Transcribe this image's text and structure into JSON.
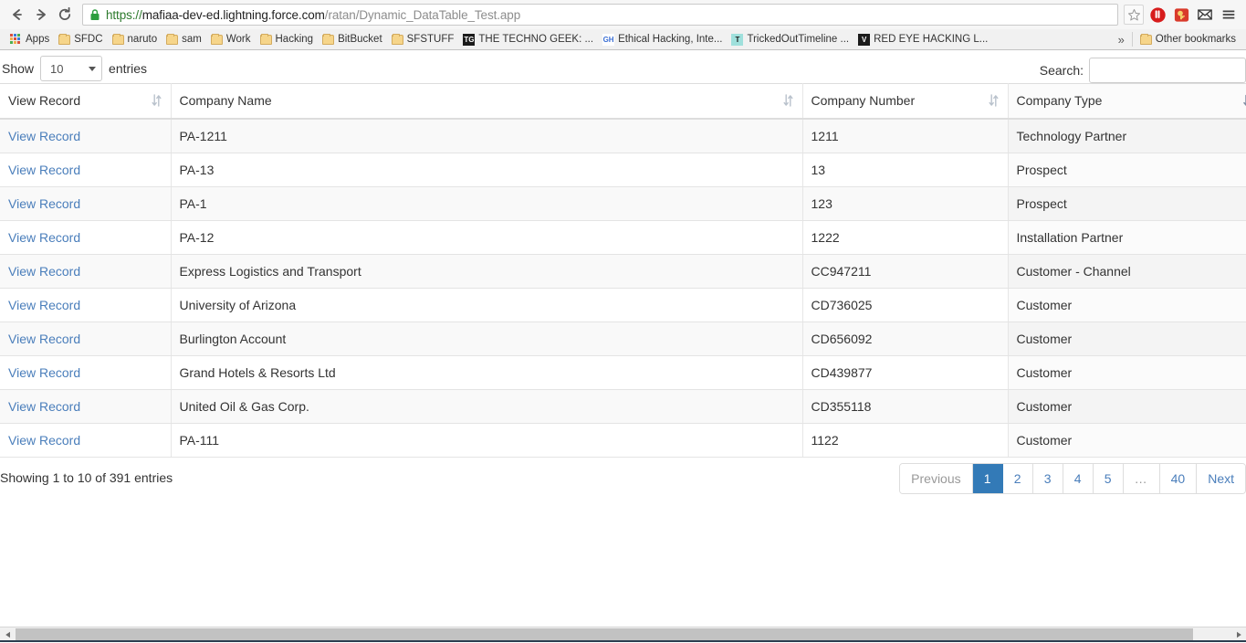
{
  "browser": {
    "nav": {
      "back_icon": "arrow-left-icon",
      "forward_icon": "arrow-right-icon",
      "reload_icon": "reload-icon"
    },
    "omnibox": {
      "lock_icon": "lock-icon",
      "url_scheme": "https://",
      "url_host": "mafiaa-dev-ed.lightning.force.com",
      "url_path": "/ratan/Dynamic_DataTable_Test.app",
      "star_icon": "star-icon"
    },
    "extensions": [
      {
        "name": "adblock-icon",
        "label": ""
      },
      {
        "name": "lastpass-icon",
        "label": ""
      },
      {
        "name": "mail-icon",
        "label": ""
      },
      {
        "name": "chrome-menu-icon",
        "label": ""
      }
    ],
    "bookmarks": [
      {
        "label": "Apps",
        "icon": "apps-grid-icon",
        "type": "apps"
      },
      {
        "label": "SFDC",
        "icon": "folder-icon",
        "type": "folder"
      },
      {
        "label": "naruto",
        "icon": "folder-icon",
        "type": "folder"
      },
      {
        "label": "sam",
        "icon": "folder-icon",
        "type": "folder"
      },
      {
        "label": "Work",
        "icon": "folder-icon",
        "type": "folder"
      },
      {
        "label": "Hacking",
        "icon": "folder-icon",
        "type": "folder"
      },
      {
        "label": "BitBucket",
        "icon": "folder-icon",
        "type": "folder"
      },
      {
        "label": "SFSTUFF",
        "icon": "folder-icon",
        "type": "folder"
      },
      {
        "label": "THE TECHNO GEEK: ...",
        "icon": "site-icon",
        "type": "site",
        "badge": "TG",
        "badge_bg": "#1b1b1b",
        "badge_fg": "#ffffff"
      },
      {
        "label": "Ethical Hacking, Inte...",
        "icon": "site-icon",
        "type": "site",
        "badge": "GH",
        "badge_bg": "#ffffff",
        "badge_fg": "#3b6fd4"
      },
      {
        "label": "TrickedOutTimeline ...",
        "icon": "site-icon",
        "type": "site",
        "badge": "T",
        "badge_bg": "#9fe0dc",
        "badge_fg": "#1b1b1b"
      },
      {
        "label": "RED EYE HACKING L...",
        "icon": "site-icon",
        "type": "site",
        "badge": "V",
        "badge_bg": "#1b1b1b",
        "badge_fg": "#ffffff"
      }
    ],
    "overflow_label": "»",
    "other_bookmarks": {
      "label": "Other bookmarks",
      "icon": "folder-icon"
    }
  },
  "datatable": {
    "length": {
      "prefix_label": "Show",
      "value": "10",
      "suffix_label": "entries",
      "caret_icon": "chevron-down-icon"
    },
    "search": {
      "label": "Search:",
      "value": "",
      "placeholder": ""
    },
    "columns": [
      {
        "label": "View Record",
        "sort_icon": "sort-both-icon",
        "sorted": false
      },
      {
        "label": "Company Name",
        "sort_icon": "sort-both-icon",
        "sorted": false
      },
      {
        "label": "Company Number",
        "sort_icon": "sort-both-icon",
        "sorted": false
      },
      {
        "label": "Company Type",
        "sort_icon": "sort-desc-icon",
        "sorted": true
      }
    ],
    "row_action_label": "View Record",
    "rows": [
      {
        "action": "View Record",
        "name": "PA-1211",
        "number": "1211",
        "type": "Technology Partner"
      },
      {
        "action": "View Record",
        "name": "PA-13",
        "number": "13",
        "type": "Prospect"
      },
      {
        "action": "View Record",
        "name": "PA-1",
        "number": "123",
        "type": "Prospect"
      },
      {
        "action": "View Record",
        "name": "PA-12",
        "number": "1222",
        "type": "Installation Partner"
      },
      {
        "action": "View Record",
        "name": "Express Logistics and Transport",
        "number": "CC947211",
        "type": "Customer - Channel"
      },
      {
        "action": "View Record",
        "name": "University of Arizona",
        "number": "CD736025",
        "type": "Customer"
      },
      {
        "action": "View Record",
        "name": "Burlington Account",
        "number": "CD656092",
        "type": "Customer"
      },
      {
        "action": "View Record",
        "name": "Grand Hotels & Resorts Ltd",
        "number": "CD439877",
        "type": "Customer"
      },
      {
        "action": "View Record",
        "name": "United Oil & Gas Corp.",
        "number": "CD355118",
        "type": "Customer"
      },
      {
        "action": "View Record",
        "name": "PA-111",
        "number": "1122",
        "type": "Customer"
      }
    ],
    "info": "Showing 1 to 10 of 391 entries",
    "pagination": {
      "previous_label": "Previous",
      "next_label": "Next",
      "pages": [
        "1",
        "2",
        "3",
        "4",
        "5",
        "…",
        "40"
      ],
      "active_page": "1",
      "active_color": "#337ab7",
      "link_color": "#4a7ebb"
    }
  },
  "scrollbar": {
    "left_arrow_icon": "triangle-left-icon",
    "right_arrow_icon": "triangle-right-icon"
  }
}
